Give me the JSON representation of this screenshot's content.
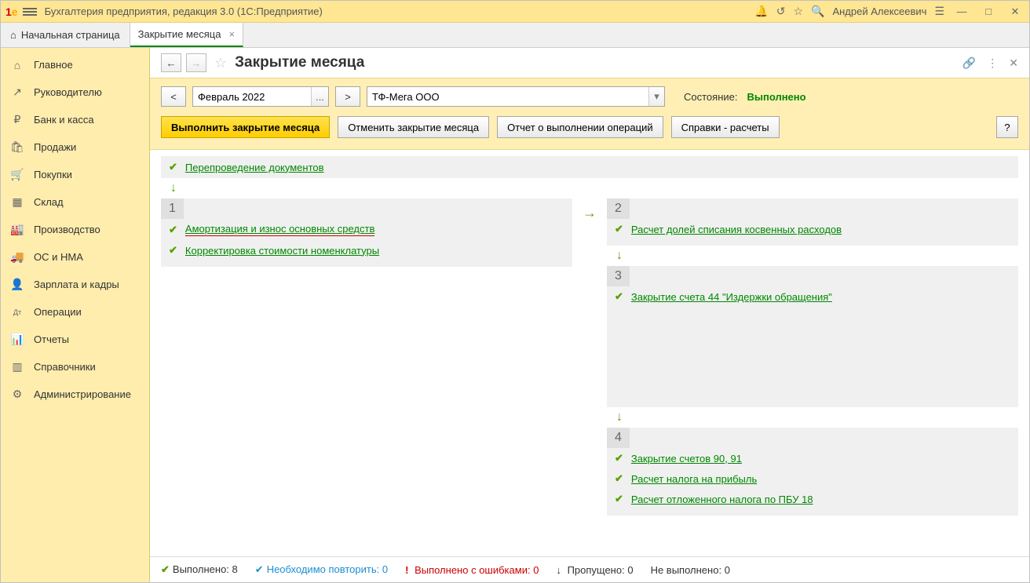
{
  "title": "Бухгалтерия предприятия, редакция 3.0  (1С:Предприятие)",
  "user": "Андрей Алексеевич",
  "tabs": {
    "home": "Начальная страница",
    "active": "Закрытие месяца"
  },
  "sidebar": {
    "items": [
      {
        "icon": "⌂",
        "label": "Главное"
      },
      {
        "icon": "↗",
        "label": "Руководителю"
      },
      {
        "icon": "₽",
        "label": "Банк и касса"
      },
      {
        "icon": "🛍",
        "label": "Продажи"
      },
      {
        "icon": "🛒",
        "label": "Покупки"
      },
      {
        "icon": "▦",
        "label": "Склад"
      },
      {
        "icon": "🏭",
        "label": "Производство"
      },
      {
        "icon": "🚚",
        "label": "ОС и НМА"
      },
      {
        "icon": "👤",
        "label": "Зарплата и кадры"
      },
      {
        "icon": "Дт",
        "label": "Операции"
      },
      {
        "icon": "📊",
        "label": "Отчеты"
      },
      {
        "icon": "▥",
        "label": "Справочники"
      },
      {
        "icon": "⚙",
        "label": "Администрирование"
      }
    ]
  },
  "page": {
    "title": "Закрытие месяца",
    "period": "Февраль 2022",
    "organization": "ТФ-Мега ООО",
    "status_label": "Состояние:",
    "status_value": "Выполнено",
    "buttons": {
      "execute": "Выполнить закрытие месяца",
      "cancel": "Отменить закрытие месяца",
      "report": "Отчет о выполнении операций",
      "references": "Справки - расчеты",
      "help": "?"
    },
    "pre_stage": "Перепроведение документов",
    "stages": {
      "s1": [
        "Амортизация и износ основных средств",
        "Корректировка стоимости номенклатуры"
      ],
      "s2": [
        "Расчет долей списания косвенных расходов"
      ],
      "s3": [
        "Закрытие счета 44 \"Издержки обращения\""
      ],
      "s4": [
        "Закрытие счетов 90, 91",
        "Расчет налога на прибыль",
        "Расчет отложенного налога по ПБУ 18"
      ]
    },
    "footer": {
      "done_label": "Выполнено:",
      "done_count": "8",
      "repeat_label": "Необходимо повторить:",
      "repeat_count": "0",
      "errors_label": "Выполнено с ошибками:",
      "errors_count": "0",
      "skipped_label": "Пропущено:",
      "skipped_count": "0",
      "notdone_label": "Не выполнено:",
      "notdone_count": "0"
    }
  }
}
